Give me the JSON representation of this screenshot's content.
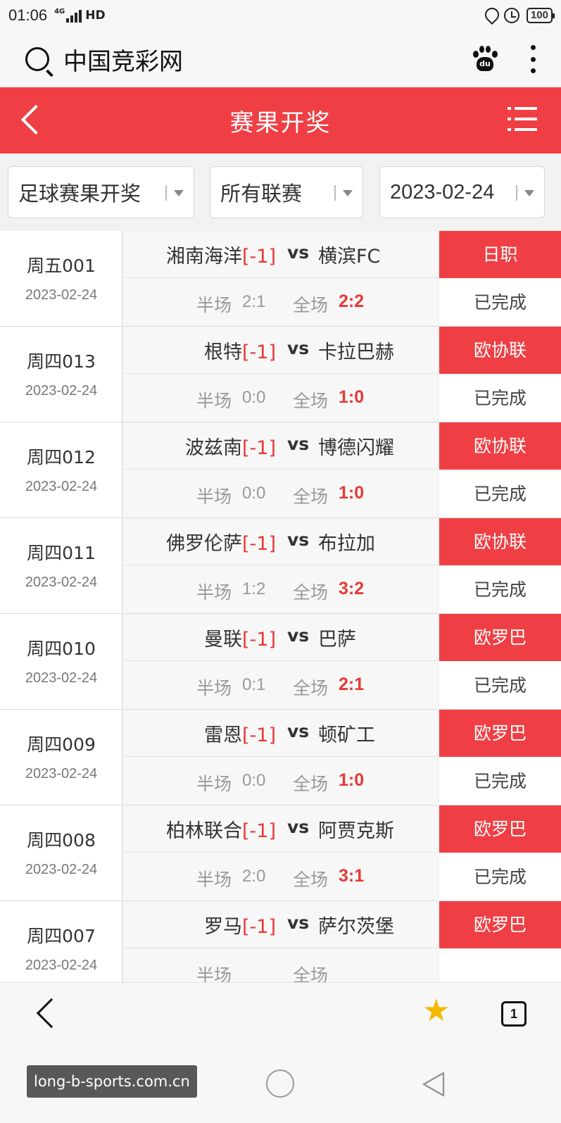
{
  "status_bar": {
    "time": "01:06",
    "network": "4G",
    "hd": "HD",
    "battery": "100"
  },
  "browser": {
    "site_title": "中国竞彩网"
  },
  "header": {
    "title": "赛果开奖"
  },
  "filters": {
    "sport": "足球赛果开奖",
    "league": "所有联赛",
    "date": "2023-02-24"
  },
  "labels": {
    "vs": "vs",
    "half": "半场",
    "full": "全场"
  },
  "matches": [
    {
      "code": "周五001",
      "date": "2023-02-24",
      "home": "湘南海洋",
      "handicap": "[-1]",
      "away": "横滨FC",
      "half": "2:1",
      "full": "2:2",
      "league": "日职",
      "status": "已完成"
    },
    {
      "code": "周四013",
      "date": "2023-02-24",
      "home": "根特",
      "handicap": "[-1]",
      "away": "卡拉巴赫",
      "half": "0:0",
      "full": "1:0",
      "league": "欧协联",
      "status": "已完成"
    },
    {
      "code": "周四012",
      "date": "2023-02-24",
      "home": "波兹南",
      "handicap": "[-1]",
      "away": "博德闪耀",
      "half": "0:0",
      "full": "1:0",
      "league": "欧协联",
      "status": "已完成"
    },
    {
      "code": "周四011",
      "date": "2023-02-24",
      "home": "佛罗伦萨",
      "handicap": "[-1]",
      "away": "布拉加",
      "half": "1:2",
      "full": "3:2",
      "league": "欧协联",
      "status": "已完成"
    },
    {
      "code": "周四010",
      "date": "2023-02-24",
      "home": "曼联",
      "handicap": "[-1]",
      "away": "巴萨",
      "half": "0:1",
      "full": "2:1",
      "league": "欧罗巴",
      "status": "已完成"
    },
    {
      "code": "周四009",
      "date": "2023-02-24",
      "home": "雷恩",
      "handicap": "[-1]",
      "away": "顿矿工",
      "half": "0:0",
      "full": "1:0",
      "league": "欧罗巴",
      "status": "已完成"
    },
    {
      "code": "周四008",
      "date": "2023-02-24",
      "home": "柏林联合",
      "handicap": "[-1]",
      "away": "阿贾克斯",
      "half": "2:0",
      "full": "3:1",
      "league": "欧罗巴",
      "status": "已完成"
    },
    {
      "code": "周四007",
      "date": "2023-02-24",
      "home": "罗马",
      "handicap": "[-1]",
      "away": "萨尔茨堡",
      "half": "",
      "full": "",
      "league": "欧罗巴",
      "status": ""
    }
  ],
  "toolbar": {
    "tab_count": "1"
  },
  "watermark": "long-b-sports.com.cn",
  "icons": {
    "search": "search-icon",
    "baidu": "paw-icon",
    "more": "more-vertical-icon",
    "back": "chevron-left-icon",
    "menu": "list-menu-icon",
    "star": "star-icon",
    "tabs": "tabs-icon"
  },
  "colors": {
    "accent": "#ef3f44",
    "score": "#e53935",
    "star": "#f5b800"
  }
}
